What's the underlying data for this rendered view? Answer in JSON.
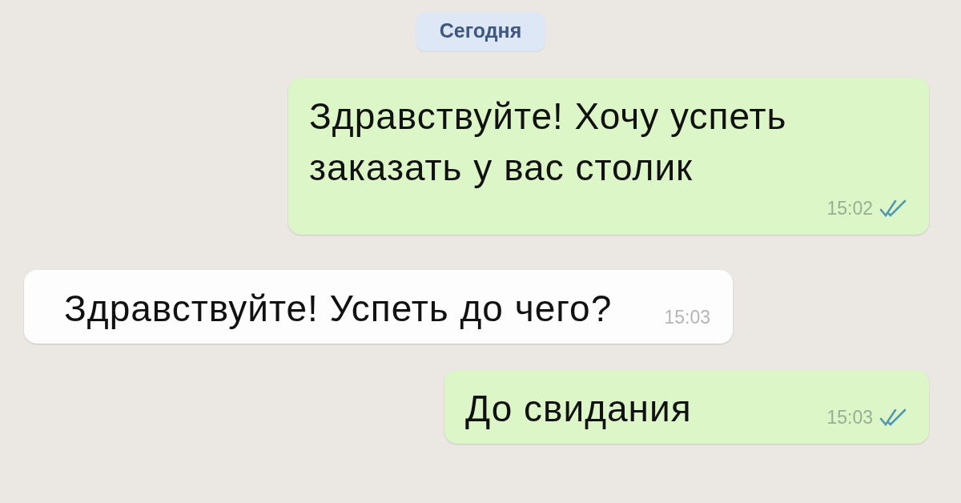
{
  "date_chip": {
    "label": "Сегодня"
  },
  "messages": [
    {
      "kind": "outgoing",
      "text": "Здравствуйте! Хочу успеть заказать у вас столик",
      "time": "15:02",
      "read": true
    },
    {
      "kind": "incoming",
      "text": "Здравствуйте! Успеть до чего?",
      "time": "15:03"
    },
    {
      "kind": "outgoing",
      "text": "До свидания",
      "time": "15:03",
      "read": true
    }
  ]
}
